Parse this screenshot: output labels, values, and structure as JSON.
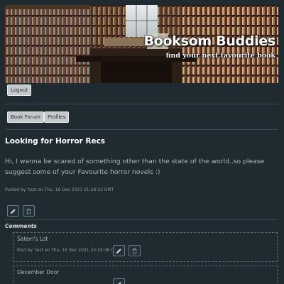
{
  "site": {
    "title": "Booksom Buddies",
    "tagline": "find your next favourite book"
  },
  "nav": {
    "logout_label": "Logout",
    "book_forum_label": "Book Forum",
    "profiles_label": "Profiles"
  },
  "post": {
    "title": "Looking for Horror Recs",
    "body": "Hi, I wanna be scared of something other than the state of the world..so please suggest some of your Favourite horror novels :)",
    "meta": "Posted by: test on Thu, 16 Dec 2021 21:28:23 GMT",
    "edit_icon": "pencil-icon",
    "delete_icon": "trash-icon"
  },
  "comments": {
    "label": "Comments",
    "items": [
      {
        "title": "Salem's Lot",
        "meta": "Post by: test on Thu, 16 Dec 2021 23:34:36 GMT"
      },
      {
        "title": "December Door",
        "meta": ""
      }
    ]
  },
  "colors": {
    "background": "#1f2b30",
    "button": "#c4c8cc",
    "text": "#d9dde0"
  }
}
